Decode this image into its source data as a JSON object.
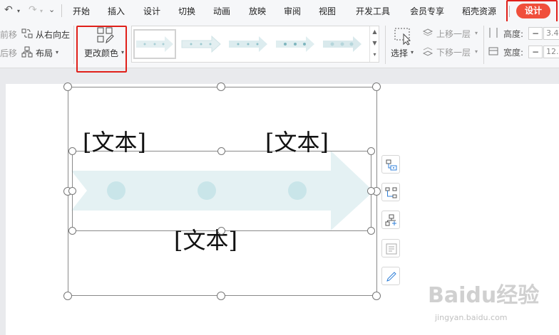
{
  "quick_access": {
    "undo": "↶",
    "undo_caret": "▾",
    "redo": "↷",
    "redo_caret": "▾",
    "more": "⌄"
  },
  "tabs": [
    "开始",
    "插入",
    "设计",
    "切换",
    "动画",
    "放映",
    "审阅",
    "视图",
    "开发工具",
    "会员专享",
    "稻壳资源"
  ],
  "active_tab": "设计",
  "ribbon": {
    "move_forward": "前移",
    "move_back": "后移",
    "right_to_left": "从右向左",
    "layout": "布局",
    "change_color": "更改颜色",
    "select": "选择",
    "bring_forward": "上移一层",
    "send_backward": "下移一层",
    "height_label": "高度:",
    "width_label": "宽度:",
    "height_value": "3.4",
    "width_value": "12."
  },
  "canvas": {
    "placeholder_top_left": "[文本]",
    "placeholder_top_right": "[文本]",
    "placeholder_bottom": "[文本]"
  },
  "side_tools": [
    "add-shape-icon",
    "change-layout-icon",
    "change-color-icon",
    "text-pane-icon",
    "format-style-icon"
  ],
  "watermark": {
    "main": "Baidu经验",
    "sub": "jingyan.baidu.com"
  },
  "colors": {
    "accent": "#f04f3b",
    "highlight_box": "#e0201a",
    "arrow": "#e4f1f3",
    "node": "#c9e5e9"
  }
}
